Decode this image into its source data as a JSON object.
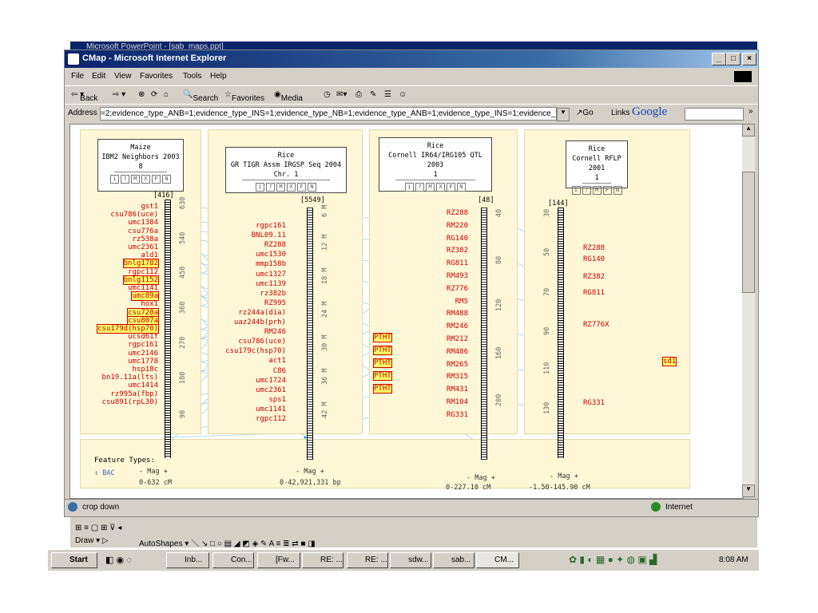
{
  "ppt_title": "Microsoft PowerPoint - [sab_maps.ppt]",
  "window": {
    "title": "CMap - Microsoft Internet Explorer"
  },
  "menu": [
    "File",
    "Edit",
    "View",
    "Favorites",
    "Tools",
    "Help"
  ],
  "toolbar": {
    "back": "Back",
    "search": "Search",
    "favorites": "Favorites",
    "media": "Media"
  },
  "address": {
    "label": "Address",
    "value": "=2;evidence_type_ANB=1;evidence_type_INS=1;evidence_type_NB=1;evidence_type_ANB=1;evidence_type_INS=1;evidence_type_",
    "go": "Go",
    "links": "Links",
    "google": "Google"
  },
  "status": {
    "text": "crop down",
    "zone": "Internet"
  },
  "maps": [
    {
      "species": "Maize",
      "set": "IBM2 Neighbors 2003",
      "name": "8",
      "count": "[416]",
      "range": "0-632 cM",
      "mag": "- Mag +",
      "ticks": [
        "630",
        "540",
        "450",
        "360",
        "270",
        "180",
        "90"
      ]
    },
    {
      "species": "Rice",
      "set": "GR TIGR Assm IRGSP Seq 2004",
      "name": "Chr. 1",
      "count": "[5549]",
      "range": "0-42,921,331 bp",
      "mag": "- Mag +",
      "ticks": [
        "6 M",
        "12 M",
        "18 M",
        "24 M",
        "30 M",
        "36 M",
        "42 M"
      ]
    },
    {
      "species": "Rice",
      "set": "Cornell IR64/IRG105 QTL 2003",
      "name": "1",
      "count": "[48]",
      "range": "0-227.10 cM",
      "mag": "- Mag +",
      "ticks": [
        "40",
        "80",
        "120",
        "160",
        "200"
      ]
    },
    {
      "species": "Rice",
      "set": "Cornell RFLP 2001",
      "name": "1",
      "count": "[144]",
      "range": "-1.50-145.90 cM",
      "mag": "- Mag +",
      "ticks": [
        "30",
        "50",
        "70",
        "90",
        "110",
        "130"
      ]
    }
  ],
  "map_icons": [
    "i",
    "?",
    "M",
    "X",
    "F",
    "N"
  ],
  "map_icons_rflp": [
    "i",
    "?",
    "M",
    "F",
    "N"
  ],
  "maize_labels": [
    "gst1",
    "csu786(uce)",
    "umc1384",
    "csu776a",
    "rz538a",
    "umc2361",
    "ald1",
    "bnlg1782",
    "rgpc112",
    "bnlg1152",
    "umc1141",
    "umc89a",
    "hox1",
    "csu720a",
    "csu807a",
    "csu179d(hsp70)",
    "ucsd61f",
    "rgpc161",
    "umc2146",
    "umc1778",
    "hsp18c",
    "bn19.11a(lts)",
    "umc1414",
    "rz995a(fbp)",
    "csu891(rpL30)"
  ],
  "maize_highlight": [
    "bnlg1782",
    "bnlg1152",
    "umc89a",
    "csu720a",
    "csu807a",
    "csu179d(hsp70)"
  ],
  "rice_seq_labels": [
    "rgpc161",
    "BNL09.11",
    "RZ288",
    "umc1530",
    "mmp158b",
    "umc1327",
    "umc1139",
    "rz382b",
    "RZ995",
    "rz244a(dia)",
    "uaz244b(prh)",
    "RM246",
    "csu786(uce)",
    "csu179c(hsp70)",
    "act1",
    "C86",
    "umc1724",
    "umc2361",
    "sps1",
    "umc1141",
    "rgpc112"
  ],
  "qtl_labels": [
    "RZ288",
    "RM220",
    "RG140",
    "RZ382",
    "RG811",
    "RM493",
    "RZ776",
    "RM5",
    "RM488",
    "RM246",
    "RM212",
    "RM486",
    "RM265",
    "RM315",
    "RM431",
    "RM104",
    "RG331"
  ],
  "ptht_labels": [
    "PTHT",
    "PTHT",
    "PTHT",
    "PTHT",
    "PTHT"
  ],
  "rflp_labels": [
    "RZ288",
    "RG140",
    "RZ382",
    "RG811",
    "RZ776X",
    "RG331"
  ],
  "sd1_label": "sd1",
  "feature_types": {
    "title": "Feature Types:",
    "item": "BAC"
  },
  "taskbar": {
    "start": "Start",
    "items": [
      "Inb...",
      "Con...",
      "[Fw...",
      "RE: ...",
      "RE: ...",
      "sdw...",
      "sab...",
      "CM..."
    ],
    "clock": "8:08 AM"
  },
  "draw_toolbar": {
    "draw": "Draw",
    "autoshapes": "AutoShapes"
  }
}
